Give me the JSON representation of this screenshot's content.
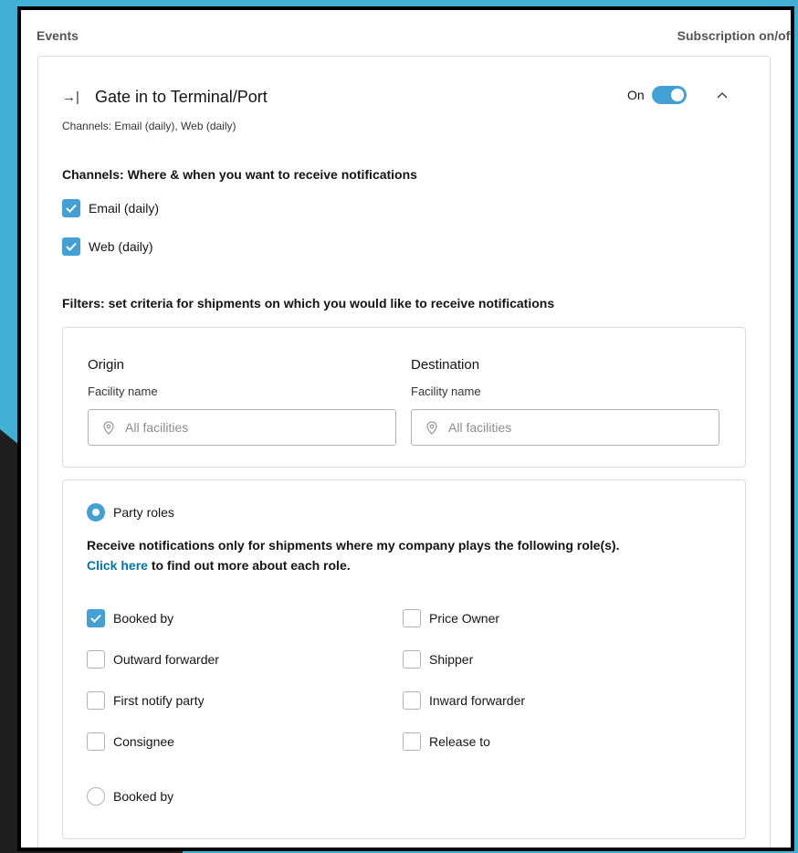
{
  "header": {
    "events_label": "Events",
    "subscription_label": "Subscription on/off"
  },
  "event": {
    "title": "Gate in to Terminal/Port",
    "channels_summary": "Channels: Email (daily), Web (daily)",
    "toggle_label": "On",
    "toggle_state": "on"
  },
  "channels": {
    "heading": "Channels: Where & when you want to receive notifications",
    "items": [
      {
        "label": "Email (daily)",
        "checked": true
      },
      {
        "label": "Web (daily)",
        "checked": true
      }
    ]
  },
  "filters": {
    "heading": "Filters: set criteria for shipments on which you would like to receive notifications",
    "origin": {
      "label": "Origin",
      "sublabel": "Facility name",
      "placeholder": "All facilities"
    },
    "destination": {
      "label": "Destination",
      "sublabel": "Facility name",
      "placeholder": "All facilities"
    }
  },
  "party_roles": {
    "radio_label": "Party roles",
    "description": "Receive notifications only for shipments where my company plays the following role(s).",
    "link_text": "Click here",
    "link_suffix": " to find out more about each role.",
    "roles": [
      {
        "label": "Booked by",
        "checked": true
      },
      {
        "label": "Price Owner",
        "checked": false
      },
      {
        "label": "Outward forwarder",
        "checked": false
      },
      {
        "label": "Shipper",
        "checked": false
      },
      {
        "label": "First notify party",
        "checked": false
      },
      {
        "label": "Inward forwarder",
        "checked": false
      },
      {
        "label": "Consignee",
        "checked": false
      },
      {
        "label": "Release to",
        "checked": false
      }
    ],
    "second_radio_label": "Booked by"
  },
  "colors": {
    "accent": "#42a0d5",
    "background": "#42b0d5",
    "link": "#0073ab"
  }
}
